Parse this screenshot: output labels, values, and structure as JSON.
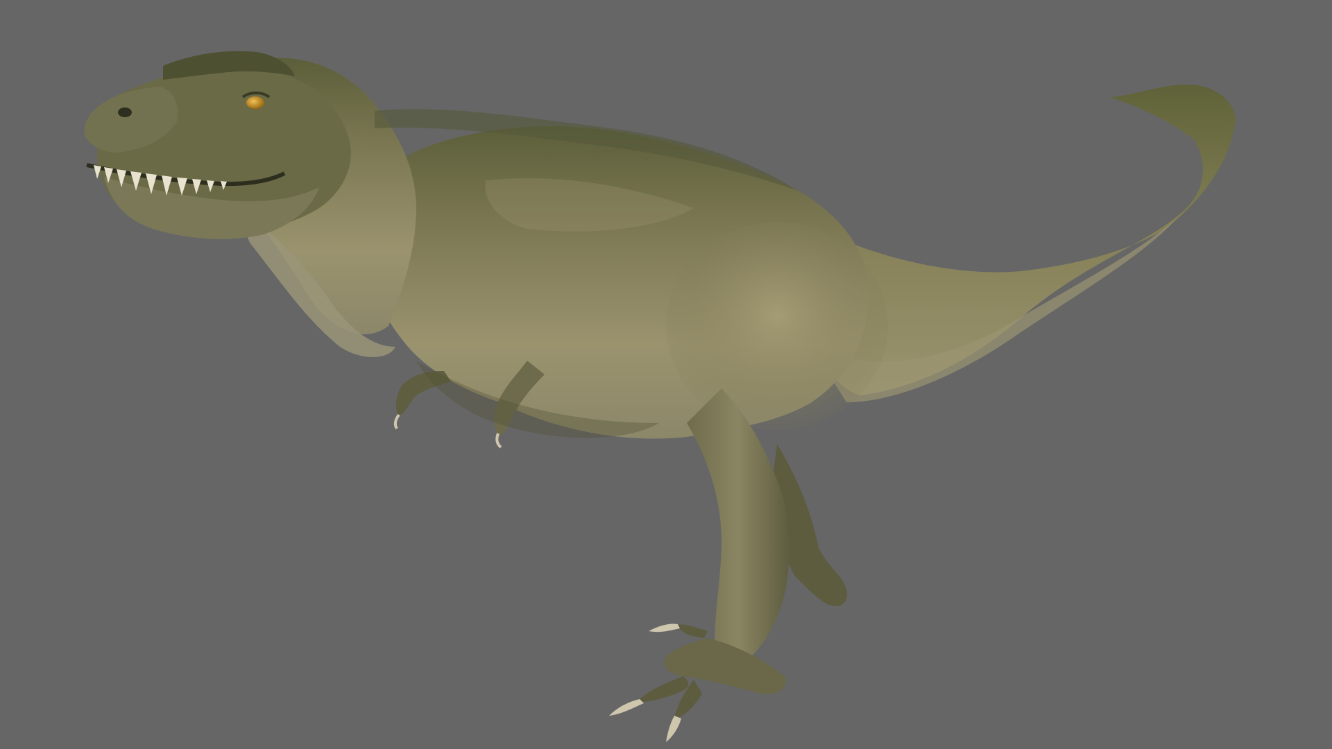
{
  "scene": {
    "subject": "tyrannosaurus-rex",
    "background_color": "#666666",
    "colors": {
      "skin_base": "#7f7a56",
      "skin_dark": "#4f5232",
      "skin_light": "#a29a72",
      "belly": "#8e8a6c",
      "eye": "#c9901f",
      "teeth": "#e8e2cf",
      "claw": "#cfc6ae"
    }
  }
}
